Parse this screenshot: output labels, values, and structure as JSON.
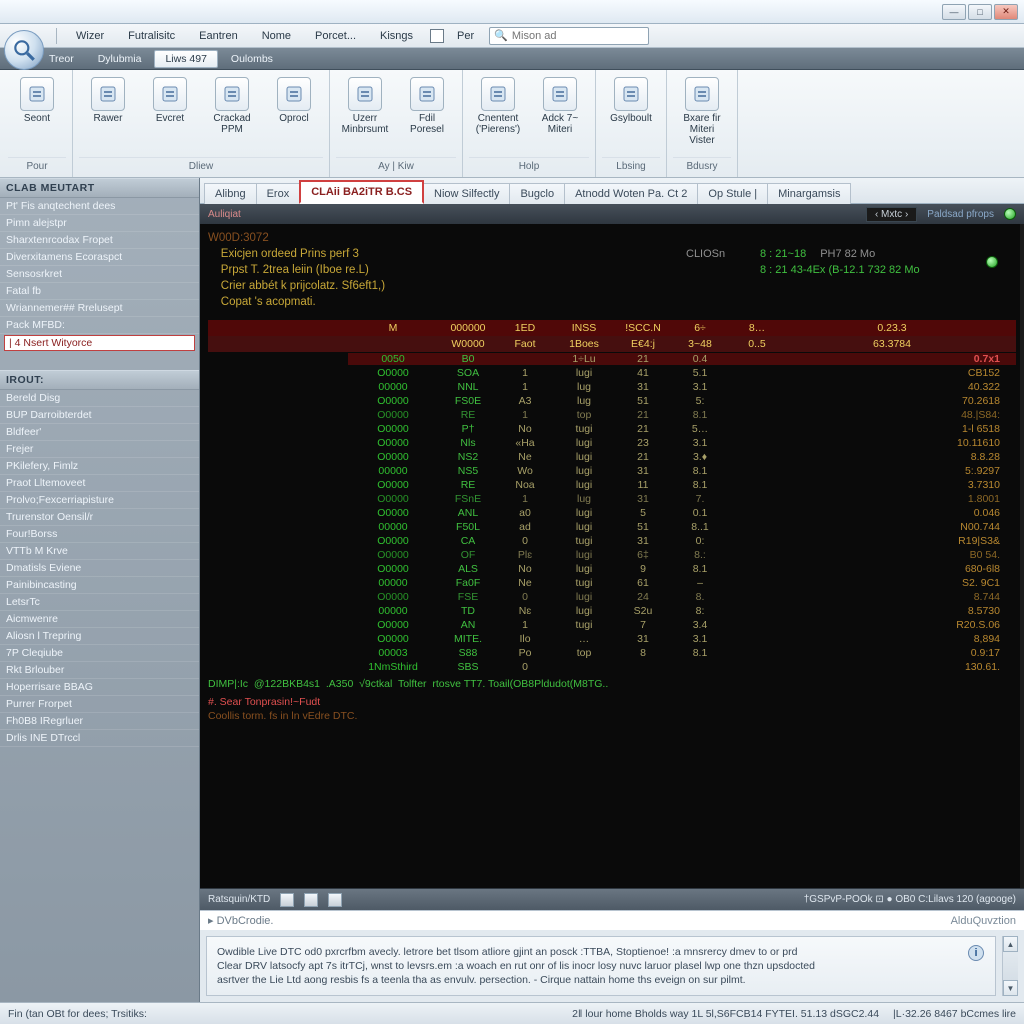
{
  "window": {
    "min": "—",
    "max": "□",
    "close": "✕"
  },
  "menu": {
    "items": [
      "Wizer",
      "Futralisitc",
      "Eantren",
      "Nome",
      "Porcet...",
      "Kisngs",
      "Per"
    ],
    "search_placeholder": "Mison ad"
  },
  "toolbar2": {
    "items": [
      "Treor",
      "Dylubmia",
      "Liws 497",
      "Oulombs"
    ],
    "active_index": 2
  },
  "ribbon": {
    "groups": [
      {
        "label": "Pour",
        "buttons": [
          {
            "t": "Seont"
          }
        ]
      },
      {
        "label": "Dliew",
        "buttons": [
          {
            "t": "Rawer"
          },
          {
            "t": "Evcret"
          },
          {
            "t": "Crackad PPM"
          },
          {
            "t": "Oprocl"
          }
        ]
      },
      {
        "label": "Ay | Kiw",
        "buttons": [
          {
            "t": "Uzerr Minbrsumt"
          },
          {
            "t": "Fdil Poresel"
          }
        ]
      },
      {
        "label": "Holp",
        "buttons": [
          {
            "t": "Cnentent ('Pierens')"
          },
          {
            "t": "Adck 7~ Miteri"
          }
        ]
      },
      {
        "label": "Lbsing",
        "buttons": [
          {
            "t": "Gsylboult"
          }
        ]
      },
      {
        "label": "Bdusry",
        "buttons": [
          {
            "t": "Bxare fir Miteri Vister"
          }
        ]
      }
    ]
  },
  "side": {
    "panel1_title": "CLAB MEUTART",
    "panel1_items": [
      "Pt' Fis anqtechent dees",
      "Pimn alejstpr",
      "Sharxtenrcodax Fropet",
      "Diverxitamens Ecoraspct",
      "Sensosrkret",
      "Fatal fb",
      "Wriannemer## Rrelusept",
      "Pack MFBD:",
      "| 4 Nsert  Wityorce"
    ],
    "panel1_selected": 8,
    "panel2_title": "IROUT:",
    "panel2_items": [
      "Bereld Disg",
      "BUP  Darroibterdet",
      "Bldfeer'",
      "Frejer",
      "PKilefery, Fimlz",
      "Praot Lltemoveet",
      "Prolvo;Fexcerriapisture",
      "Trurenstor Oensil/r",
      "Four!Borss",
      "VTTb M Krve",
      "Dmatisls Eviene",
      "Painibincasting",
      "LetsrTc",
      "Aicmwenre",
      "Aliosn l Trepring",
      "7P Cleqiube",
      "Rkt Brlouber",
      "Hoperrisare BBAG",
      "Purrer Frorpet",
      "Fh0B8 IRegrluer",
      "Drlis INE DTrccl"
    ]
  },
  "doc_tabs": {
    "items": [
      "Alibng",
      "Erox",
      "CLAii BA2iTR B.CS",
      "Niow Silfectly",
      "Bugclo",
      "Atnodd Woten Pa. Ct 2",
      "Op Stule |",
      "Minargamsis"
    ],
    "active_index": 2
  },
  "term_hdr": {
    "left": "Auliqiat",
    "mid_btn": "‹ Mxtc ›",
    "right": "Paldsad pfrops"
  },
  "log": {
    "ts": "W00D:3072",
    "lines": [
      "Exicjen ordeed Prins perf 3",
      "Prpst T. 2trea leiin (Iboe re.L)",
      "Crier abbét k prijcolatz. Sf6eft1,)",
      "Copat 's acopmati."
    ],
    "right": [
      {
        "a": "CLIOSn",
        "b": "8 :  21~18",
        "c": "PH7 82 Mo"
      },
      {
        "a": "",
        "b": "8 : 21 43-4Ex (B-12.1 732 82 Mo",
        "c": ""
      }
    ]
  },
  "table": {
    "hdr1": [
      "M",
      "000000",
      "1ED",
      "INSS",
      "!SCC.N",
      "6÷",
      "8…",
      "0.23.3"
    ],
    "hdr2": [
      "",
      "W0000",
      "Faot",
      "1Boes",
      "E€4:j",
      "3~48",
      "0..5",
      "63.3784"
    ],
    "rows": [
      {
        "a": "0050",
        "b": "B0",
        "c": "",
        "d": "1÷Lu",
        "e": "21",
        "f": "0.4",
        "g": "0.7x1",
        "hi": true
      },
      {
        "a": "O0000",
        "b": "SOA",
        "c": "1",
        "d": "lugi",
        "e": "41",
        "f": "5.1",
        "g": "CB152"
      },
      {
        "a": "00000",
        "b": "NNL",
        "c": "1",
        "d": "lug",
        "e": "31",
        "f": "3.1",
        "g": "40.322"
      },
      {
        "a": "O0000",
        "b": "FS0E",
        "c": "A3",
        "d": "lug",
        "e": "51",
        "f": "5:",
        "g": "70.2618"
      },
      {
        "a": "O0000",
        "b": "RE",
        "c": "1",
        "d": "top",
        "e": "21",
        "f": "8.1",
        "g": "48.|S84:",
        "dim": true
      },
      {
        "a": "O0000",
        "b": "P†",
        "c": "No",
        "d": "tugi",
        "e": "21",
        "f": "5…",
        "g": "1-l 6518"
      },
      {
        "a": "O0000",
        "b": "Nls",
        "c": "«Ha",
        "d": "lugi",
        "e": "23",
        "f": "3.1",
        "g": "10.11610"
      },
      {
        "a": "O0000",
        "b": "NS2",
        "c": "Ne",
        "d": "lugi",
        "e": "21",
        "f": "3.♦",
        "g": "8.8.28"
      },
      {
        "a": "00000",
        "b": "NS5",
        "c": "Wo",
        "d": "lugi",
        "e": "31",
        "f": "8.1",
        "g": "5:.9297"
      },
      {
        "a": "O0000",
        "b": "RE",
        "c": "Noa",
        "d": "lugi",
        "e": "11",
        "f": "8.1",
        "g": "3.7310"
      },
      {
        "a": "O0000",
        "b": "FSnE",
        "c": "1",
        "d": "lug",
        "e": "31",
        "f": "7.",
        "g": "1.8001",
        "dim": true
      },
      {
        "a": "O0000",
        "b": "ANL",
        "c": "a0",
        "d": "lugi",
        "e": "5",
        "f": "0.1",
        "g": "0.046"
      },
      {
        "a": "00000",
        "b": "F50L",
        "c": "ad",
        "d": "lugi",
        "e": "51",
        "f": "8..1",
        "g": "N00.744"
      },
      {
        "a": "O0000",
        "b": "CA",
        "c": "0",
        "d": "tugi",
        "e": "31",
        "f": "0:",
        "g": "R19|S3&"
      },
      {
        "a": "O0000",
        "b": "OF",
        "c": "Plɛ",
        "d": "lugi",
        "e": "6‡",
        "f": "8.:",
        "g": "B0 54.",
        "dim": true
      },
      {
        "a": "O0000",
        "b": "ALS",
        "c": "No",
        "d": "lugi",
        "e": "9",
        "f": "8.1",
        "g": "680-6l8"
      },
      {
        "a": "00000",
        "b": "Fa0F",
        "c": "Ne",
        "d": "tugi",
        "e": "61",
        "f": "–",
        "g": "S2. 9C1"
      },
      {
        "a": "O0000",
        "b": "FSE",
        "c": "0",
        "d": "lugi",
        "e": "24",
        "f": "8.",
        "g": "8.744",
        "dim": true
      },
      {
        "a": "00000",
        "b": "TD",
        "c": "Nɛ",
        "d": "lugi",
        "e": "S2u",
        "f": "8:",
        "g": "8.5730"
      },
      {
        "a": "O0000",
        "b": "AN",
        "c": "1",
        "d": "tugi",
        "e": "7",
        "f": "3.4",
        "g": "R20.S.06"
      },
      {
        "a": "O0000",
        "b": "MITE.",
        "c": "Ilo",
        "d": "…",
        "e": "31",
        "f": "3.1",
        "g": "8,894"
      },
      {
        "a": "00003",
        "b": "S88",
        "c": "Po",
        "d": "top",
        "e": "8",
        "f": "8.1",
        "g": "0.9:17"
      },
      {
        "a": "1NmSthird",
        "b": "SBS",
        "c": "0",
        "d": "",
        "e": "",
        "f": "",
        "g": "130.61."
      }
    ],
    "sum": "DIMP|:Ic  @122BKB4s1  .A350  √9ctkal  Tolfter  rtosve TT7. Toail(OB8Pldudot(M8TG.."
  },
  "errors": {
    "l1": "#. Sear Tonprasin!~Fudt",
    "l2": "Coollis torm. fs in ln vEdre  DTC."
  },
  "term_foot": {
    "left": "Ratsquin/KTD",
    "right": "†GSPvP-POOk  ⊡  ● OB0  C:Lilavs 120 (agooge)"
  },
  "input_line": {
    "prompt": "▸ DVbCrodie.",
    "aux": "AlduQuvztion"
  },
  "hint": {
    "l1": "Owdible Live DTC od0 pxrcrfbm avecly. letrore bet tlsom atliore gjint an posck :TTBA, Stoptienoe! :a mnsrercy dmev to or prd",
    "l2": "Clear DRV latsocfy apt 7s itrTCj, wnst to levsrs.em :a woach en rut onr of lis inocr losy nuvc laruor plasel lwp one thzn upsdocted",
    "l3": "asrtver the Lie Ltd aong resbis fs a teenla tha as envulv. persection.     - Cirque nattain home ths eveign on sur pilmt."
  },
  "status": {
    "left": "Fin (tan OBt for dees;  Trsitiks:",
    "mid": "2‖ lour home Bholds way 1L  5l,S6FCB14  FYTEI.  51.13 dSGC2.44",
    "right": "|L·32.26  8467 bCcmes lire"
  }
}
